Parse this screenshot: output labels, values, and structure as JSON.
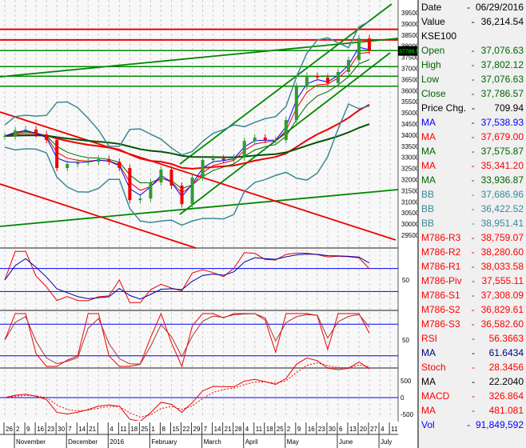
{
  "symbol": "KSE100",
  "header": {
    "date_label": "Date",
    "date_value": "06/29/2016",
    "value_label": "Value",
    "value_value": "36,214.54"
  },
  "last_price_tag": "37786.57",
  "info_rows": [
    {
      "label": "Open",
      "value": "37,076.63",
      "color": "#006400"
    },
    {
      "label": "High",
      "value": "37,802.12",
      "color": "#006400"
    },
    {
      "label": "Low",
      "value": "37,076.63",
      "color": "#006400"
    },
    {
      "label": "Close",
      "value": "37,786.57",
      "color": "#006400"
    },
    {
      "label": "Price Chg.",
      "value": "709.94",
      "color": "#000000"
    },
    {
      "label": "MA",
      "value": "37,538.93",
      "color": "#0000ff"
    },
    {
      "label": "MA",
      "value": "37,679.00",
      "color": "#ff0000"
    },
    {
      "label": "MA",
      "value": "37,575.87",
      "color": "#006400"
    },
    {
      "label": "MA",
      "value": "35,341.20",
      "color": "#ff0000"
    },
    {
      "label": "MA",
      "value": "33,936.87",
      "color": "#006400"
    },
    {
      "label": "BB",
      "value": "37,686.96",
      "color": "#3a8a96"
    },
    {
      "label": "BB",
      "value": "36,422.52",
      "color": "#3a8a96"
    },
    {
      "label": "BB",
      "value": "38,951.41",
      "color": "#3a8a96"
    },
    {
      "label": "M786-R3",
      "value": "38,759.07",
      "color": "#ff0000"
    },
    {
      "label": "M786-R2",
      "value": "38,280.60",
      "color": "#ff0000"
    },
    {
      "label": "M786-R1",
      "value": "38,033.58",
      "color": "#ff0000"
    },
    {
      "label": "M786-Piv",
      "value": "37,555.11",
      "color": "#ff0000"
    },
    {
      "label": "M786-S1",
      "value": "37,308.09",
      "color": "#ff0000"
    },
    {
      "label": "M786-S2",
      "value": "36,829.61",
      "color": "#ff0000"
    },
    {
      "label": "M786-S3",
      "value": "36,582.60",
      "color": "#ff0000"
    },
    {
      "label": "RSI",
      "value": "56.3663",
      "color": "#ff0000"
    },
    {
      "label": "MA",
      "value": "61.6434",
      "color": "#000080"
    },
    {
      "label": "Stoch",
      "value": "28.3456",
      "color": "#ff0000"
    },
    {
      "label": "MA",
      "value": "22.2040",
      "color": "#000000"
    },
    {
      "label": "MACD",
      "value": "326.864",
      "color": "#ff0000"
    },
    {
      "label": "MA",
      "value": "481.081",
      "color": "#ff0000"
    },
    {
      "label": "Vol",
      "value": "91,849,592",
      "color": "#0000ff"
    }
  ],
  "chart_data": {
    "type": "line",
    "grid": true,
    "ylim": [
      29500,
      39500
    ],
    "y_ticks": [
      "39500",
      "39000",
      "38500",
      "38000",
      "37500",
      "37000",
      "36500",
      "36000",
      "35500",
      "35000",
      "34500",
      "34000",
      "33500",
      "33000",
      "32500",
      "32000",
      "31500",
      "31000",
      "30500",
      "30000",
      "29500"
    ],
    "x_tick_labels": [
      "26",
      "2",
      "9",
      "16",
      "23",
      "30",
      "7",
      "14",
      "21",
      "",
      "4",
      "11",
      "18",
      "25",
      "1",
      "8",
      "15",
      "22",
      "29",
      "7",
      "14",
      "21",
      "28",
      "4",
      "11",
      "18",
      "25",
      "2",
      "9",
      "16",
      "23",
      "30",
      "6",
      "13",
      "20",
      "27",
      "4",
      "11"
    ],
    "month_labels": [
      {
        "label": "November",
        "at": 1
      },
      {
        "label": "December",
        "at": 6
      },
      {
        "label": "2016",
        "at": 10
      },
      {
        "label": "February",
        "at": 14
      },
      {
        "label": "March",
        "at": 19
      },
      {
        "label": "April",
        "at": 23
      },
      {
        "label": "May",
        "at": 27
      },
      {
        "label": "June",
        "at": 32
      },
      {
        "label": "July",
        "at": 36
      }
    ],
    "close": [
      33960,
      34210,
      34250,
      34030,
      33780,
      32520,
      32700,
      32770,
      32800,
      32920,
      32800,
      32520,
      31080,
      31150,
      31870,
      32450,
      31730,
      30900,
      32090,
      32880,
      32950,
      32880,
      32990,
      33740,
      33890,
      33780,
      33780,
      34680,
      36190,
      36660,
      36590,
      36340,
      36840,
      37380,
      38350,
      37787
    ],
    "horizontal_levels": {
      "red": [
        38759.07,
        38280.6
      ],
      "green": [
        37800,
        37080,
        36650,
        36200
      ]
    },
    "rsi_panel": {
      "ticks": [
        "50"
      ],
      "levels": [
        70,
        30
      ]
    },
    "stoch_panel": {
      "ticks": [
        "50"
      ],
      "levels": [
        80,
        20
      ]
    },
    "macd_panel": {
      "ticks": [
        "500",
        "0",
        "-500"
      ]
    }
  }
}
